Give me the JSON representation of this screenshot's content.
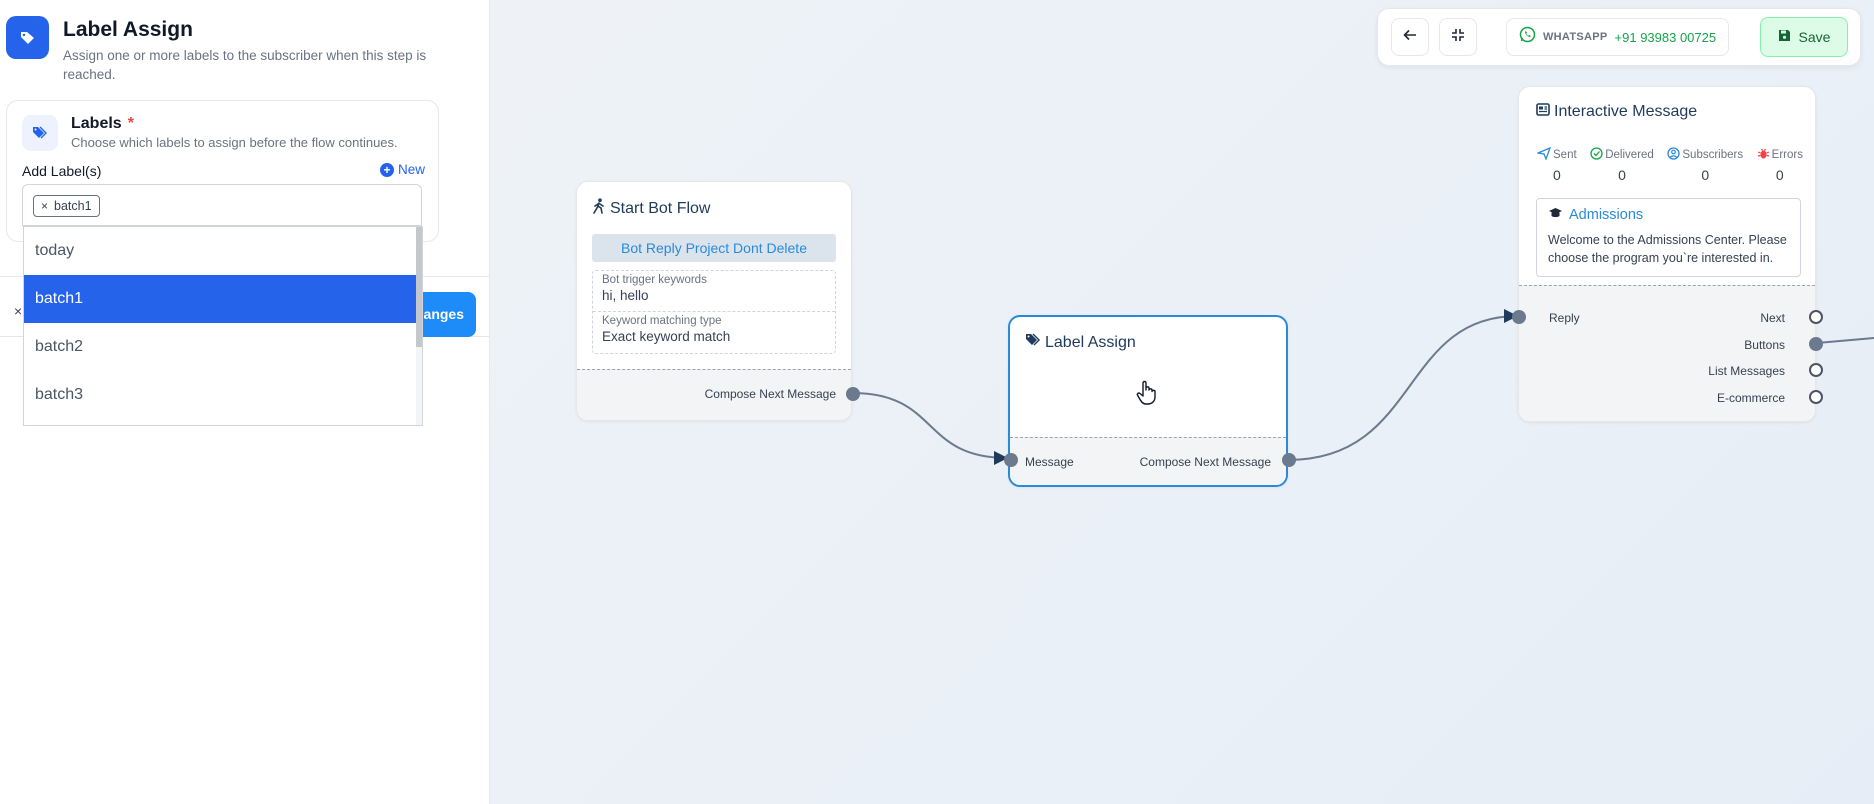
{
  "panel": {
    "title": "Label Assign",
    "description": "Assign one or more labels to the subscriber when this step is reached.",
    "card": {
      "title": "Labels",
      "required_mark": "*",
      "subtitle": "Choose which labels to assign before the flow continues.",
      "add_label": "Add Label(s)",
      "new_link": "New"
    },
    "selected_chips": [
      "batch1"
    ],
    "chip_remove": "×",
    "options": [
      {
        "label": "today",
        "selected": false
      },
      {
        "label": "batch1",
        "selected": true
      },
      {
        "label": "batch2",
        "selected": false
      },
      {
        "label": "batch3",
        "selected": false
      }
    ],
    "close_symbol": "×",
    "save_changes_label": "Save Changes"
  },
  "toolbar": {
    "whatsapp_label": "WHATSAPP",
    "whatsapp_number": "+91 93983 00725",
    "save_label": "Save"
  },
  "nodes": {
    "start": {
      "title": "Start Bot Flow",
      "project_button": "Bot Reply Project Dont Delete",
      "keywords_label": "Bot trigger keywords",
      "keywords_value": "hi, hello",
      "matching_label": "Keyword matching type",
      "matching_value": "Exact keyword match",
      "output_label": "Compose Next Message"
    },
    "label_assign": {
      "title": "Label Assign",
      "input_label": "Message",
      "output_label": "Compose Next Message"
    },
    "interactive": {
      "title": "Interactive Message",
      "stats": [
        {
          "label": "Sent",
          "value": "0",
          "icon": "send-icon",
          "color": "#2b8ad8"
        },
        {
          "label": "Delivered",
          "value": "0",
          "icon": "check-circle-icon",
          "color": "#16a34a"
        },
        {
          "label": "Subscribers",
          "value": "0",
          "icon": "user-circle-icon",
          "color": "#2b8ad8"
        },
        {
          "label": "Errors",
          "value": "0",
          "icon": "bug-icon",
          "color": "#ef4444"
        }
      ],
      "message_title": "Admissions",
      "message_body": "Welcome to the Admissions Center. Please choose the program you`re interested in.",
      "input_label": "Reply",
      "outputs": [
        "Next",
        "Buttons",
        "List Messages",
        "E-commerce"
      ]
    }
  },
  "colors": {
    "primary": "#2563eb",
    "accent": "#2b8ad8",
    "whatsapp": "#16a34a",
    "danger": "#ef4444"
  }
}
